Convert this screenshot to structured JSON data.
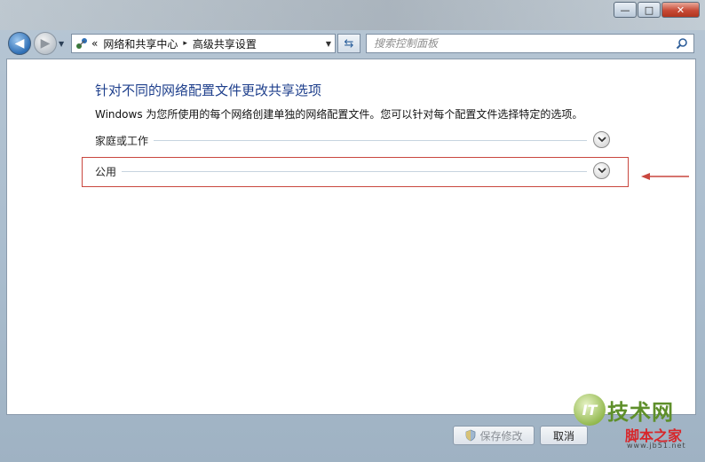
{
  "window": {
    "controls": {
      "minimize": "—",
      "maximize": "□",
      "close": "✕"
    }
  },
  "nav": {
    "back_icon": "back-arrow-icon",
    "forward_icon": "forward-arrow-icon",
    "address": {
      "prefix": "«",
      "crumbs": [
        "网络和共享中心",
        "高级共享设置"
      ],
      "separator": "▸"
    },
    "search_placeholder": "搜索控制面板"
  },
  "main": {
    "heading": "针对不同的网络配置文件更改共享选项",
    "description": "Windows 为您所使用的每个网络创建单独的网络配置文件。您可以针对每个配置文件选择特定的选项。",
    "sections": [
      {
        "label": "家庭或工作",
        "expanded": false
      },
      {
        "label": "公用",
        "expanded": false,
        "highlighted": true
      }
    ]
  },
  "footer": {
    "save_label": "保存修改",
    "cancel_label": "取消"
  },
  "watermark": {
    "logo_text": "IT",
    "site_name": "技术网",
    "site_name_2": "脚本之家",
    "url": "www.jb51.net"
  },
  "colors": {
    "heading": "#1e3f8c",
    "highlight_border": "#c9473f",
    "accent_blue": "#2f6fb5"
  }
}
